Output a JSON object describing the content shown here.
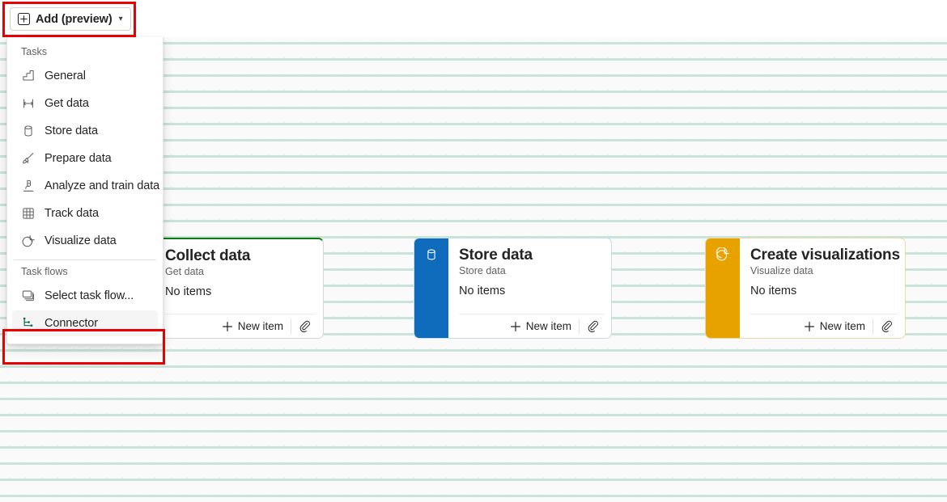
{
  "toolbar": {
    "add_button": {
      "label": "Add (preview)",
      "icon": "plus-square-icon",
      "chevron": "⌄"
    }
  },
  "menu": {
    "sections": [
      {
        "header": "Tasks",
        "items": [
          {
            "label": "General",
            "icon": "stairs-icon"
          },
          {
            "label": "Get data",
            "icon": "get-data-icon"
          },
          {
            "label": "Store data",
            "icon": "database-icon"
          },
          {
            "label": "Prepare data",
            "icon": "broom-icon"
          },
          {
            "label": "Analyze and train data",
            "icon": "microscope-icon"
          },
          {
            "label": "Track data",
            "icon": "grid-table-icon"
          },
          {
            "label": "Visualize data",
            "icon": "pie-chart-icon"
          }
        ]
      },
      {
        "header": "Task flows",
        "items": [
          {
            "label": "Select task flow...",
            "icon": "task-flow-icon"
          },
          {
            "label": "Connector",
            "icon": "connector-icon",
            "hovered": true
          }
        ]
      }
    ]
  },
  "cards": [
    {
      "title": "Collect data",
      "subtitle": "Get data",
      "items_text": "No items",
      "new_item_label": "New item",
      "accent_color": "#107C10",
      "icon": "get-data-icon"
    },
    {
      "title": "Store data",
      "subtitle": "Store data",
      "items_text": "No items",
      "new_item_label": "New item",
      "accent_color": "#0F6CBD",
      "icon": "database-icon"
    },
    {
      "title": "Create visualizations",
      "subtitle": "Visualize data",
      "items_text": "No items",
      "new_item_label": "New item",
      "accent_color": "#E8A200",
      "icon": "pie-chart-icon"
    }
  ],
  "annotations": {
    "highlight_color": "#E60000",
    "boxes": [
      "add-preview-button",
      "connector-menu-item"
    ]
  },
  "canvas": {
    "background_color": "#FAFAFA",
    "dot_color": "#CFE6DC"
  }
}
